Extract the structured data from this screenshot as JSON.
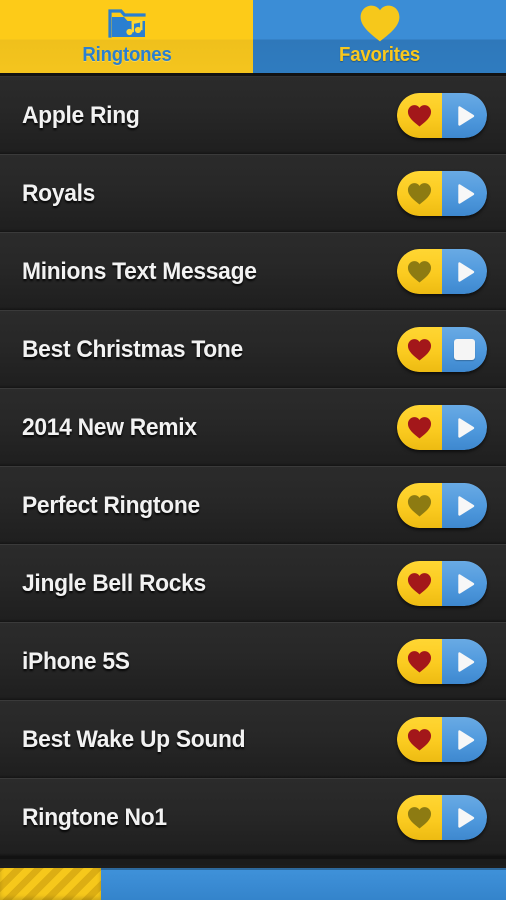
{
  "app": {
    "title": "Ringtones",
    "theme": {
      "yellow": "#fbcb20",
      "blue": "#3b8dd6",
      "row_bg": "#272727",
      "heart_on": "#a3171a",
      "heart_off": "#8d7b12",
      "text": "#f2f2f2"
    }
  },
  "tabs": [
    {
      "id": "ringtones",
      "label": "Ringtones",
      "icon": "music-folder-icon",
      "selected": true
    },
    {
      "id": "favorites",
      "label": "Favorites",
      "icon": "heart-icon",
      "selected": false
    }
  ],
  "list": {
    "items": [
      {
        "title": "Apple Ring",
        "favorite": true,
        "playing": false
      },
      {
        "title": "Royals",
        "favorite": false,
        "playing": false
      },
      {
        "title": "Minions Text Message",
        "favorite": false,
        "playing": false
      },
      {
        "title": "Best Christmas Tone",
        "favorite": true,
        "playing": true
      },
      {
        "title": "2014 New Remix",
        "favorite": true,
        "playing": false
      },
      {
        "title": "Perfect Ringtone",
        "favorite": false,
        "playing": false
      },
      {
        "title": "Jingle Bell Rocks",
        "favorite": true,
        "playing": false
      },
      {
        "title": "iPhone 5S",
        "favorite": true,
        "playing": false
      },
      {
        "title": "Best Wake Up Sound",
        "favorite": true,
        "playing": false
      },
      {
        "title": "Ringtone No1",
        "favorite": false,
        "playing": false
      }
    ],
    "favorite_icon": "heart-icon",
    "play_icon": "play-icon",
    "stop_icon": "stop-icon"
  },
  "bottom_bar": {
    "progress_percent": 20,
    "fill_style": "diagonal-stripes"
  }
}
